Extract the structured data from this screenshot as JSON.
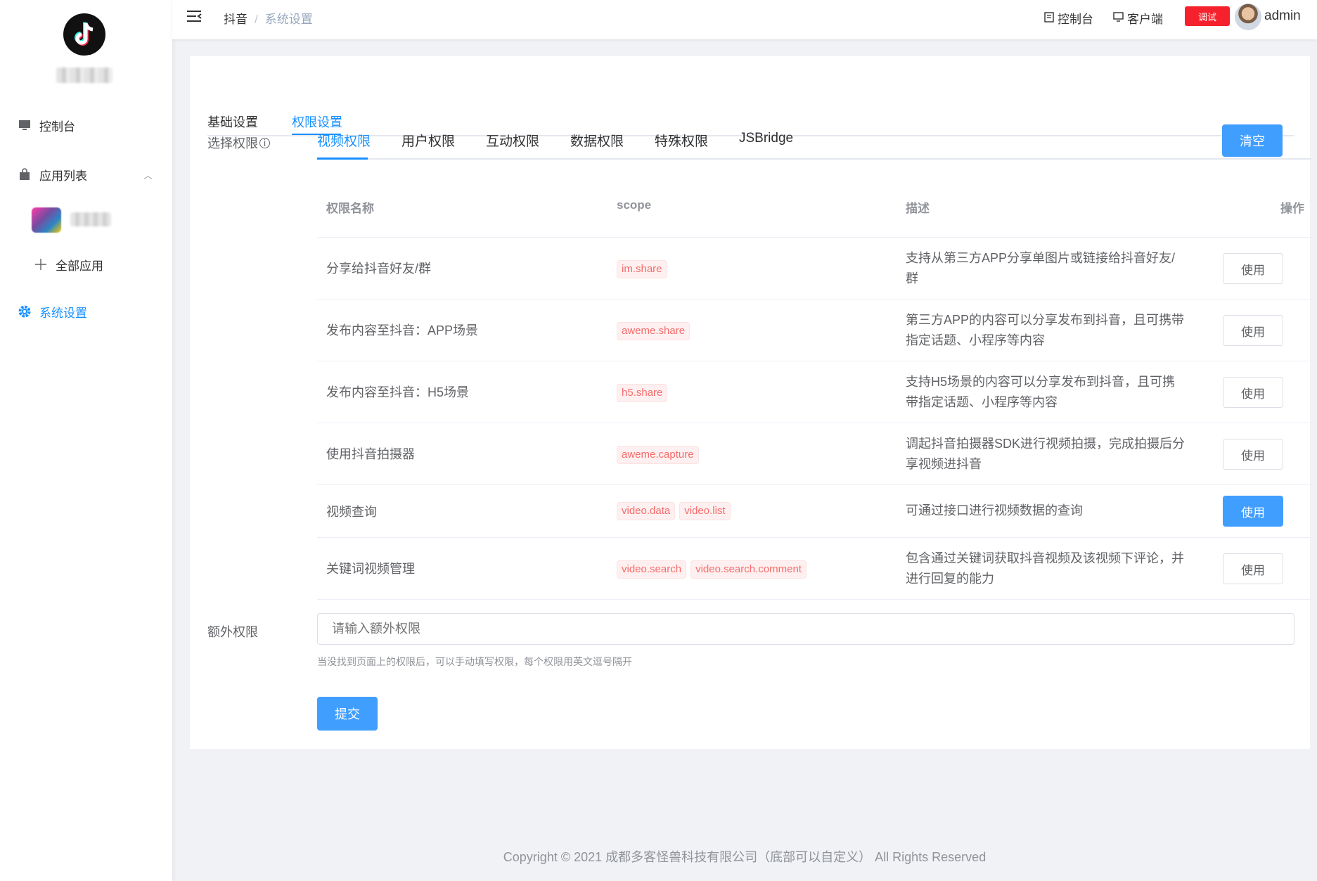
{
  "sidebar": {
    "items": [
      {
        "label": "控制台",
        "icon": "monitor-icon"
      },
      {
        "label": "应用列表",
        "icon": "bag-icon"
      },
      {
        "label": "全部应用",
        "icon": "plus-icon"
      },
      {
        "label": "系统设置",
        "icon": "gear-icon"
      }
    ]
  },
  "header": {
    "breadcrumb": {
      "root": "抖音",
      "separator": "/",
      "current": "系统设置"
    },
    "console_link": "控制台",
    "client_link": "客户端",
    "debug_label": "调试",
    "username": "admin"
  },
  "main": {
    "tabs": [
      {
        "label": "基础设置"
      },
      {
        "label": "权限设置",
        "active": true
      }
    ],
    "select_permission_label": "选择权限",
    "sub_tabs": [
      "视频权限",
      "用户权限",
      "互动权限",
      "数据权限",
      "特殊权限",
      "JSBridge"
    ],
    "clear_label": "清空",
    "table": {
      "headers": {
        "name": "权限名称",
        "scope": "scope",
        "desc": "描述",
        "action": "操作"
      },
      "rows": [
        {
          "name": "分享给抖音好友/群",
          "scopes": [
            "im.share"
          ],
          "desc": "支持从第三方APP分享单图片或链接给抖音好友/群",
          "action": "使用",
          "active": false
        },
        {
          "name": "发布内容至抖音：APP场景",
          "scopes": [
            "aweme.share"
          ],
          "desc": "第三方APP的内容可以分享发布到抖音，且可携带指定话题、小程序等内容",
          "action": "使用",
          "active": false
        },
        {
          "name": "发布内容至抖音：H5场景",
          "scopes": [
            "h5.share"
          ],
          "desc": "支持H5场景的内容可以分享发布到抖音，且可携带指定话题、小程序等内容",
          "action": "使用",
          "active": false
        },
        {
          "name": "使用抖音拍摄器",
          "scopes": [
            "aweme.capture"
          ],
          "desc": "调起抖音拍摄器SDK进行视频拍摄，完成拍摄后分享视频进抖音",
          "action": "使用",
          "active": false
        },
        {
          "name": "视频查询",
          "scopes": [
            "video.data",
            "video.list"
          ],
          "desc": "可通过接口进行视频数据的查询",
          "action": "使用",
          "active": true
        },
        {
          "name": "关键词视频管理",
          "scopes": [
            "video.search",
            "video.search.comment"
          ],
          "desc": "包含通过关键词获取抖音视频及该视频下评论，并进行回复的能力",
          "action": "使用",
          "active": false
        }
      ]
    },
    "extra_label": "额外权限",
    "extra_placeholder": "请输入额外权限",
    "extra_hint": "当没找到页面上的权限后，可以手动填写权限，每个权限用英文逗号隔开",
    "submit_label": "提交"
  },
  "footer": {
    "text": "Copyright © 2021 成都多客怪兽科技有限公司（底部可以自定义） All Rights Reserved"
  }
}
